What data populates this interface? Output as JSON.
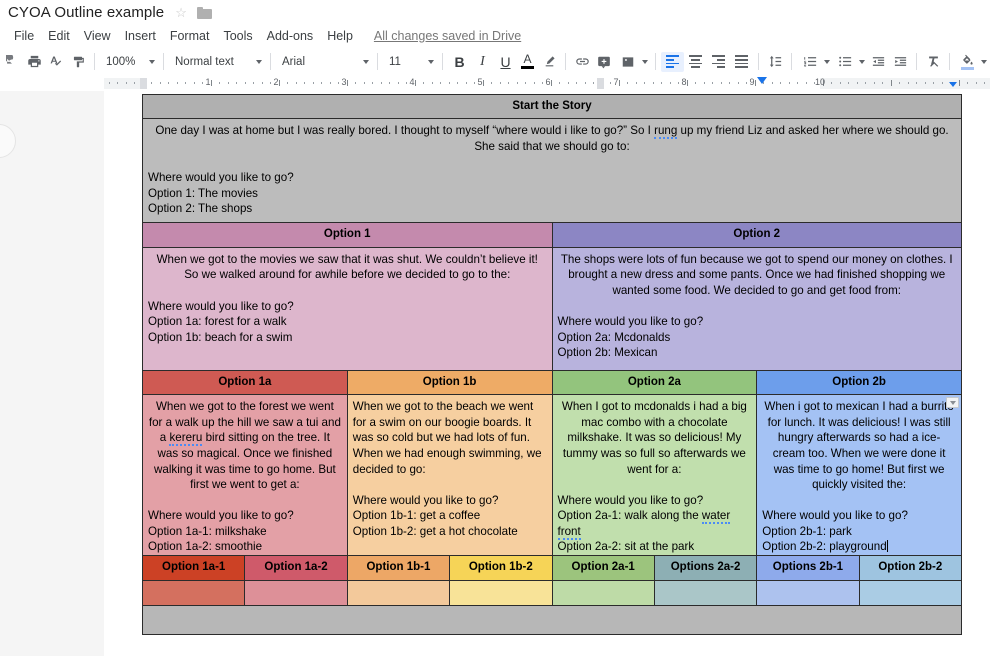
{
  "titlebar": {
    "doc_title": "CYOA Outline example",
    "star_icon": "star-outline-icon",
    "folder_icon": "folder-icon"
  },
  "menubar": {
    "items": [
      {
        "label": "File"
      },
      {
        "label": "Edit"
      },
      {
        "label": "View"
      },
      {
        "label": "Insert"
      },
      {
        "label": "Format"
      },
      {
        "label": "Tools"
      },
      {
        "label": "Add-ons"
      },
      {
        "label": "Help"
      }
    ],
    "save_status": "All changes saved in Drive"
  },
  "toolbar": {
    "undo_icon": "undo-icon",
    "print_icon": "print-icon",
    "spelling_icon": "spellcheck-icon",
    "paint_format_icon": "paint-format-icon",
    "zoom_value": "100%",
    "paragraph_style": "Normal text",
    "font_family": "Arial",
    "font_size": "11",
    "bold_label": "B",
    "italic_label": "I",
    "underline_label": "U",
    "text_color_label": "A",
    "highlight_icon": "highlight-pen-icon",
    "link_icon": "insert-link-icon",
    "comment_icon": "add-comment-icon",
    "image_icon": "insert-image-icon",
    "align_left_icon": "align-left-icon",
    "align_center_icon": "align-center-icon",
    "align_right_icon": "align-right-icon",
    "align_justify_icon": "align-justify-icon",
    "line_spacing_icon": "line-spacing-icon",
    "numbered_list_icon": "numbered-list-icon",
    "bulleted_list_icon": "bulleted-list-icon",
    "decrease_indent_icon": "decrease-indent-icon",
    "increase_indent_icon": "increase-indent-icon",
    "clear_format_icon": "clear-formatting-icon",
    "fill_color_icon": "fill-color-icon",
    "border_color_icon": "border-color-icon"
  },
  "ruler": {
    "numbers": [
      "1",
      "2",
      "3",
      "4",
      "5",
      "6",
      "7",
      "8",
      "9",
      "10"
    ],
    "left_margin_marker": "left-indent-marker",
    "right_margin_marker": "right-indent-marker"
  },
  "table": {
    "row_start": {
      "header": "Start the Story",
      "body_para_1": "One day I was at home but I was really bored. I thought to myself “where would i like to go?” So I rung up my friend Liz and asked her where we should go. She said that we should go to:",
      "body_spell_word": "rung",
      "body_prompt": "Where would you like to go?",
      "body_opt_1": "Option 1: The movies",
      "body_opt_2": "Option 2: The shops"
    },
    "row_options": [
      {
        "header": "Option 1",
        "color": "#c48aad",
        "body_color": "#ddb6cc",
        "para": "When we got to the movies we saw that it was shut. We couldn’t believe it! So we walked around for awhile before we decided to go to the:",
        "prompt": "Where would you like to go?",
        "opt_a": "Option 1a: forest for a walk",
        "opt_b": "Option 1b: beach for a swim"
      },
      {
        "header": "Option 2",
        "color": "#8c86c4",
        "body_color": "#b8b3dd",
        "para": "The shops were lots of fun because we got to spend our money on clothes. I brought a new dress and some pants. Once we had finished shopping we wanted some food. We decided to go and get food from:",
        "prompt": "Where would you like to go?",
        "opt_a": "Option 2a: Mcdonalds",
        "opt_b": "Option 2b: Mexican"
      }
    ],
    "row_sub": [
      {
        "header": "Option 1a",
        "color": "#cf5a53",
        "body_color": "#e3a0a6",
        "para": "When we got to the forest we went for a walk up the hill we saw a tui and a kereru bird sitting on the tree. It was so magical. Once we finished walking it was time to go home. But first we went to get a:",
        "spell_word": "kereru",
        "prompt": "Where would you like to go?",
        "opt_1": "Option 1a-1: milkshake",
        "opt_2": "Option 1a-2: smoothie"
      },
      {
        "header": "Option 1b",
        "color": "#eeab66",
        "body_color": "#f6cfa0",
        "para": "When we got to the beach we went for a swim on our boogie boards. It was so cold but we had lots of fun. When we had enough swimming, we decided to go:",
        "prompt": "Where would you like to go?",
        "opt_1": "Option 1b-1: get a coffee",
        "opt_2": "Option 1b-2: get a hot chocolate"
      },
      {
        "header": "Option 2a",
        "color": "#93c47d",
        "body_color": "#c1dfad",
        "para": "When I got to mcdonalds i had a big mac combo with a chocolate milkshake. It was so delicious! My tummy was so full so afterwards we went for a:",
        "prompt": "Where would you like to go?",
        "opt_1": "Option 2a-1: walk along the water front",
        "spell_word": "water front",
        "opt_2": "Option 2a-2: sit at the park"
      },
      {
        "header": "Option 2b",
        "color": "#6d9eeb",
        "body_color": "#a4c2f4",
        "para": "When i got to mexican I had a burrito for lunch. It was delicious! I was still hungry afterwards so had a ice-cream too. When we were done it was time to go home! But first we quickly visited the:",
        "prompt": "Where would you like to go?",
        "opt_1": "Option 2b-1: park",
        "opt_2": "Option 2b-2: playground",
        "has_cursor": true,
        "has_cell_handle": true
      }
    ],
    "row_leaf_headers": [
      {
        "label": "Option 1a-1",
        "color": "#cc4125",
        "body_color": "#d4705f"
      },
      {
        "label": "Option 1a-2",
        "color": "#cf5a6a",
        "body_color": "#dd9098"
      },
      {
        "label": "Option 1b-1",
        "color": "#eda766",
        "body_color": "#f3c99b"
      },
      {
        "label": "Option 1b-2",
        "color": "#f6d457",
        "body_color": "#f8e398"
      },
      {
        "label": "Option 2a-1",
        "color": "#9cc47d",
        "body_color": "#bedba7"
      },
      {
        "label": "Options 2a-2",
        "color": "#8dafb4",
        "body_color": "#aac6c8"
      },
      {
        "label": "Options 2b-1",
        "color": "#8eaaeb",
        "body_color": "#adc2ee"
      },
      {
        "label": "Option 2b-2",
        "color": "#9ec4e0",
        "body_color": "#aacce4"
      }
    ],
    "row_footer": {
      "color": "#b7b7b7"
    },
    "start_header_color": "#b0b0b0",
    "start_body_color": "#bcbcbc"
  }
}
